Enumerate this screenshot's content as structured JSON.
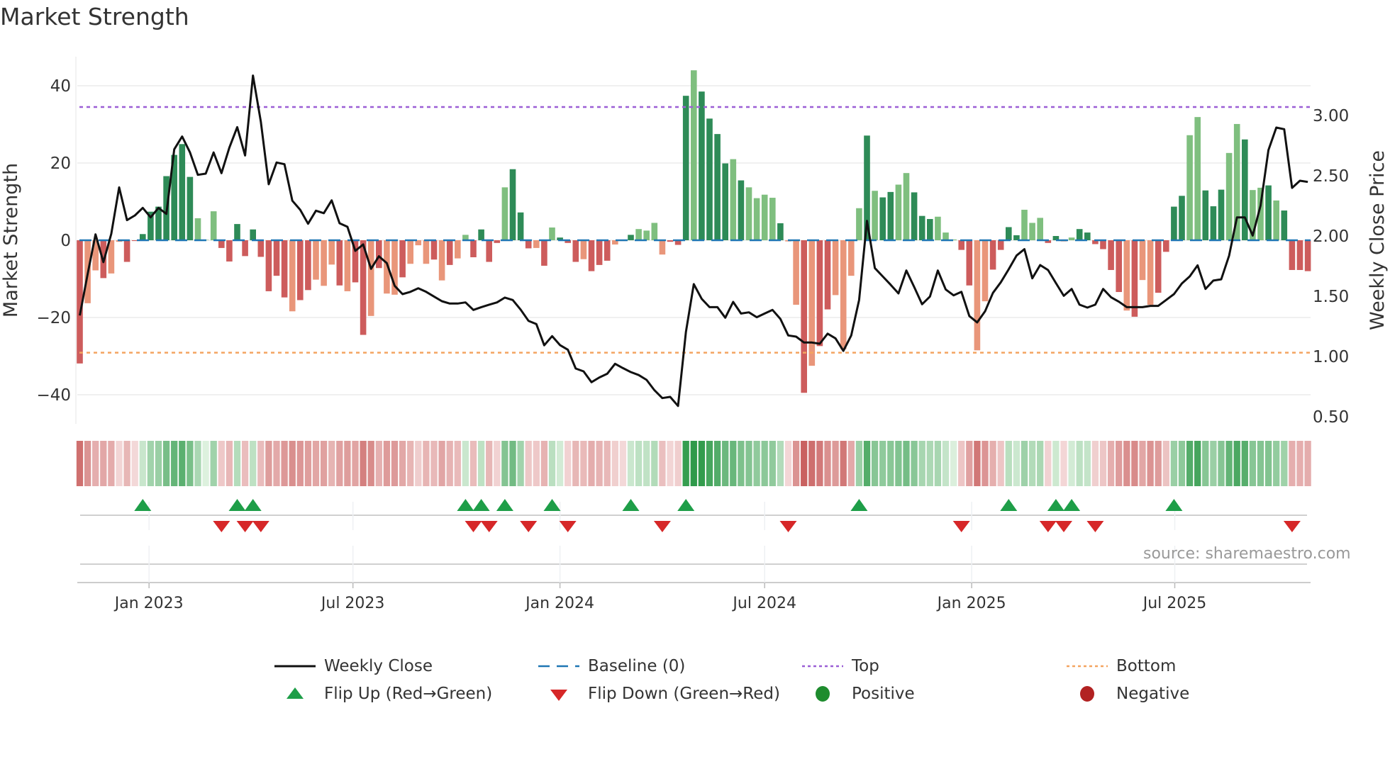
{
  "title": "Market Strength",
  "source": "source: sharemaestro.com",
  "legend": {
    "weekly_close": "Weekly Close",
    "baseline": "Baseline (0)",
    "top": "Top",
    "bottom": "Bottom",
    "flip_up": "Flip Up (Red→Green)",
    "flip_down": "Flip Down (Green→Red)",
    "positive": "Positive",
    "negative": "Negative"
  },
  "colors": {
    "pos_strong": "#2e8b57",
    "pos_weak": "#7fbf7f",
    "neg_strong": "#cd5c5c",
    "neg_weak": "#e9967a",
    "baseline": "#1f77b4",
    "top": "#9b5fd6",
    "bottom": "#f4a460",
    "close": "#111111",
    "flip_up": "#1e9e48",
    "flip_down": "#d62728",
    "positive": "#1e8c2e",
    "negative": "#b22222"
  },
  "chart_data": {
    "type": "bar+line",
    "title": "Market Strength",
    "ylabel": "Market Strength",
    "y2label": "Weekly Close Price",
    "ylim": [
      -48,
      48.5
    ],
    "y2lim": [
      0.35,
      3.2
    ],
    "yticks": [
      40,
      20,
      0,
      -20,
      -40
    ],
    "ytick_labels": [
      "40",
      "20",
      "0",
      "−20",
      "−40"
    ],
    "y2ticks": [
      3.0,
      2.5,
      2.0,
      1.5,
      1.0,
      0.5
    ],
    "y2tick_labels": [
      "3.00",
      "2.50",
      "2.00",
      "1.50",
      "1.00",
      "0.50"
    ],
    "xticks": [
      {
        "week": 9.8,
        "label": "Jan 2023"
      },
      {
        "week": 35.7,
        "label": "Jul 2023"
      },
      {
        "week": 62.0,
        "label": "Jan 2024"
      },
      {
        "week": 88.0,
        "label": "Jul 2024"
      },
      {
        "week": 114.3,
        "label": "Jan 2025"
      },
      {
        "week": 140.1,
        "label": "Jul 2025"
      }
    ],
    "top_level": 34.5,
    "bottom_level": -29.1,
    "baseline": 0,
    "strength": [
      -31.9,
      -16.3,
      -7.8,
      -9.8,
      -8.6,
      -0.4,
      -5.6,
      -0.2,
      1.6,
      7.4,
      8.7,
      16.6,
      22.1,
      24.9,
      16.4,
      5.7,
      0.1,
      7.5,
      -2.0,
      -5.5,
      4.2,
      -4.1,
      2.8,
      -4.3,
      -13.2,
      -9.2,
      -14.8,
      -18.4,
      -15.5,
      -12.9,
      -10.2,
      -11.8,
      -6.3,
      -11.7,
      -13.2,
      -10.9,
      -24.5,
      -19.6,
      -7.2,
      -13.8,
      -14.1,
      -9.6,
      -6.1,
      -1.3,
      -6.1,
      -5.0,
      -10.4,
      -6.4,
      -4.7,
      1.4,
      -4.4,
      2.8,
      -5.6,
      -0.7,
      13.7,
      18.4,
      7.2,
      -2.1,
      -2.0,
      -6.6,
      3.3,
      0.7,
      -0.7,
      -5.6,
      -4.9,
      -8.0,
      -6.4,
      -5.3,
      -1.1,
      -0.2,
      1.4,
      2.9,
      2.5,
      4.5,
      -3.7,
      -0.4,
      -1.2,
      37.4,
      44.0,
      38.5,
      31.5,
      27.5,
      19.9,
      21.0,
      15.5,
      13.7,
      10.9,
      11.8,
      11.0,
      4.4,
      -0.3,
      -16.7,
      -39.5,
      -32.5,
      -27.4,
      -17.9,
      -14.2,
      -28.2,
      -9.2,
      8.3,
      27.1,
      12.8,
      11.1,
      12.5,
      14.4,
      17.4,
      12.4,
      6.3,
      5.5,
      6.1,
      2.0,
      0.2,
      -2.5,
      -11.7,
      -28.5,
      -15.8,
      -7.6,
      -2.5,
      3.4,
      1.3,
      7.9,
      4.5,
      5.8,
      -0.7,
      1.1,
      -0.3,
      0.7,
      2.9,
      2.0,
      -1.0,
      -2.3,
      -7.7,
      -13.4,
      -18.2,
      -19.8,
      -10.3,
      -16.7,
      -13.6,
      -3.0,
      8.7,
      11.5,
      27.2,
      31.9,
      12.9,
      8.8,
      13.1,
      22.6,
      30.1,
      26.1,
      13.0,
      13.6,
      14.2,
      10.3,
      7.7,
      -7.7,
      -7.7,
      -8.0
    ],
    "strong": "dlldlldddddddddllldddddddddlddllldlddldlldllldldllddddldddldldddldddlddlllldddlddddldlllldlldlddlllldlddlldddlllddllddddlllddllddddddldllddddlldddlldlldlddddddldlldddddllddldlldld",
    "close": [
      1.376,
      1.72,
      2.049,
      1.818,
      2.053,
      2.439,
      2.167,
      2.206,
      2.269,
      2.19,
      2.269,
      2.219,
      2.755,
      2.861,
      2.729,
      2.543,
      2.553,
      2.729,
      2.557,
      2.769,
      2.939,
      2.704,
      3.367,
      2.984,
      2.465,
      2.645,
      2.631,
      2.328,
      2.253,
      2.137,
      2.245,
      2.225,
      2.331,
      2.141,
      2.112,
      1.912,
      1.965,
      1.763,
      1.867,
      1.81,
      1.622,
      1.553,
      1.572,
      1.602,
      1.572,
      1.533,
      1.494,
      1.475,
      1.475,
      1.484,
      1.422,
      1.445,
      1.465,
      1.484,
      1.524,
      1.504,
      1.425,
      1.331,
      1.304,
      1.128,
      1.204,
      1.13,
      1.092,
      0.935,
      0.912,
      0.822,
      0.861,
      0.892,
      0.975,
      0.939,
      0.906,
      0.881,
      0.841,
      0.755,
      0.69,
      0.7,
      0.625,
      1.239,
      1.636,
      1.514,
      1.445,
      1.445,
      1.357,
      1.488,
      1.392,
      1.402,
      1.361,
      1.392,
      1.422,
      1.347,
      1.21,
      1.2,
      1.151,
      1.151,
      1.141,
      1.225,
      1.186,
      1.082,
      1.21,
      1.504,
      2.161,
      1.769,
      1.7,
      1.631,
      1.559,
      1.749,
      1.612,
      1.469,
      1.533,
      1.749,
      1.592,
      1.543,
      1.572,
      1.371,
      1.318,
      1.41,
      1.563,
      1.651,
      1.759,
      1.873,
      1.926,
      1.684,
      1.794,
      1.753,
      1.645,
      1.539,
      1.596,
      1.465,
      1.441,
      1.465,
      1.596,
      1.527,
      1.49,
      1.445,
      1.445,
      1.445,
      1.455,
      1.455,
      1.504,
      1.553,
      1.641,
      1.7,
      1.792,
      1.596,
      1.665,
      1.676,
      1.872,
      2.19,
      2.19,
      2.039,
      2.288,
      2.749,
      2.935,
      2.922,
      2.435,
      2.494,
      2.484
    ],
    "flip_up": [
      9,
      21,
      23,
      50,
      52,
      55,
      61,
      71,
      78,
      100,
      119,
      125,
      127,
      140
    ],
    "flip_down": [
      19,
      22,
      24,
      51,
      53,
      58,
      63,
      75,
      91,
      113,
      124,
      126,
      130,
      155
    ],
    "legend_position": "bottom"
  }
}
